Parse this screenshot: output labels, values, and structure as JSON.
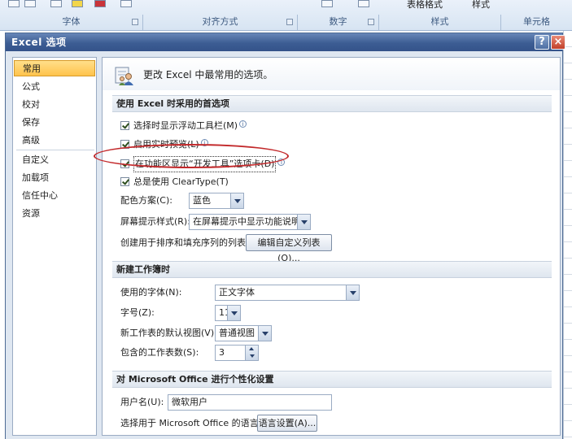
{
  "ribbon": {
    "top_items": [
      "表格格式",
      "样式"
    ],
    "groups": [
      "字体",
      "对齐方式",
      "数字",
      "样式",
      "单元格"
    ]
  },
  "dialog": {
    "title": "Excel 选项",
    "help_label": "?",
    "close_label": "×"
  },
  "nav": {
    "items": [
      {
        "label": "常用",
        "active": true
      },
      {
        "label": "公式"
      },
      {
        "label": "校对"
      },
      {
        "label": "保存"
      },
      {
        "label": "高级"
      },
      {
        "label": "自定义"
      },
      {
        "label": "加载项"
      },
      {
        "label": "信任中心"
      },
      {
        "label": "资源"
      }
    ]
  },
  "content": {
    "header": "更改 Excel 中最常用的选项。",
    "sections": {
      "top": "使用 Excel 时采用的首选项",
      "workbook": "新建工作簿时",
      "personalize": "对 Microsoft Office 进行个性化设置"
    },
    "options": {
      "mini_toolbar": "选择时显示浮动工具栏(M)",
      "live_preview": "启用实时预览(L)",
      "developer_tab": "在功能区显示“开发工具”选项卡(D)",
      "cleartype": "总是使用 ClearType(T)"
    },
    "color_scheme": {
      "label": "配色方案(C):",
      "value": "蓝色"
    },
    "screentip": {
      "label": "屏幕提示样式(R):",
      "value": "在屏幕提示中显示功能说明"
    },
    "custom_lists": {
      "label": "创建用于排序和填充序列的列表:",
      "button": "编辑自定义列表(O)..."
    },
    "font": {
      "label": "使用的字体(N):",
      "value": "正文字体"
    },
    "font_size": {
      "label": "字号(Z):",
      "value": "11"
    },
    "default_view": {
      "label": "新工作表的默认视图(V):",
      "value": "普通视图"
    },
    "sheet_count": {
      "label": "包含的工作表数(S):",
      "value": "3"
    },
    "username": {
      "label": "用户名(U):",
      "value": "微软用户"
    },
    "language": {
      "label": "选择用于 Microsoft Office 的语言:",
      "button": "语言设置(A)..."
    }
  },
  "colors": {
    "title_bar": "#3c5d93",
    "nav_active": "#ffc34c",
    "annotation": "#c2282a"
  }
}
